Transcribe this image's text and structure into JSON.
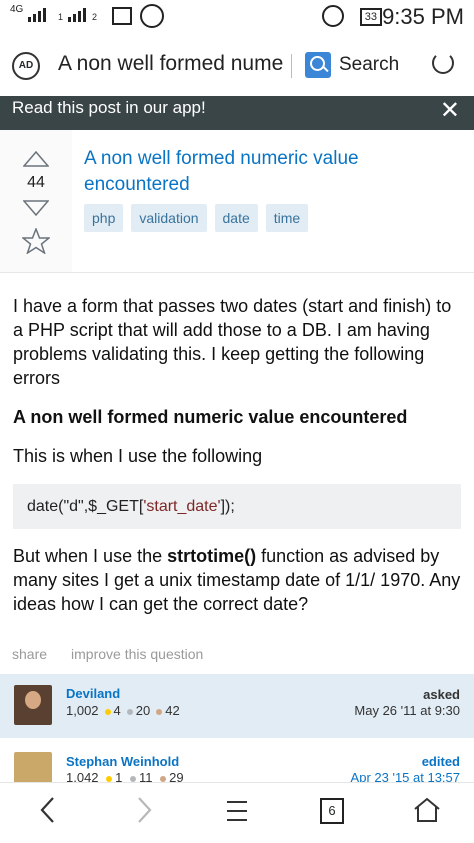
{
  "status_bar": {
    "network": "4G",
    "sim2": "1",
    "sim3": "2",
    "battery": "33",
    "time": "9:35 PM"
  },
  "address_bar": {
    "adblock_label": "AD",
    "url_text": "A non well formed nume",
    "search_label": "Search"
  },
  "banner": {
    "text": "Read this post in our app!",
    "close": "✕"
  },
  "question": {
    "score": "44",
    "title": "A non well formed numeric value encountered",
    "tags": [
      "php",
      "validation",
      "date",
      "time"
    ],
    "body_p1": "I have a form that passes two dates (start and finish) to a PHP script that will add those to a DB. I am having problems validating this. I keep getting the following errors",
    "body_bold": "A non well formed numeric value encountered",
    "body_p3": "This is when I use the following",
    "code_pre": "date(\"d\",$_GET[",
    "code_str": "'start_date'",
    "code_post": "]);",
    "body_p4_pre": "But when I use the ",
    "body_p4_bold": "strtotime()",
    "body_p4_post": " function as advised by many sites I get a unix timestamp date of 1/1/ 1970. Any ideas how I can get the correct date?"
  },
  "actions": {
    "share": "share",
    "improve": "improve this question"
  },
  "asker": {
    "name": "Deviland",
    "reputation": "1,002",
    "gold": "4",
    "silver": "20",
    "bronze": "42",
    "label": "asked",
    "time": "May 26 '11 at 9:30"
  },
  "editor": {
    "name": "Stephan Weinhold",
    "reputation": "1,042",
    "gold": "1",
    "silver": "11",
    "bronze": "29",
    "label": "edited",
    "time": "Apr 23 '15 at 13:57"
  },
  "nav": {
    "back": "‹",
    "forward": "›",
    "menu": "☰",
    "tabs": "6"
  }
}
